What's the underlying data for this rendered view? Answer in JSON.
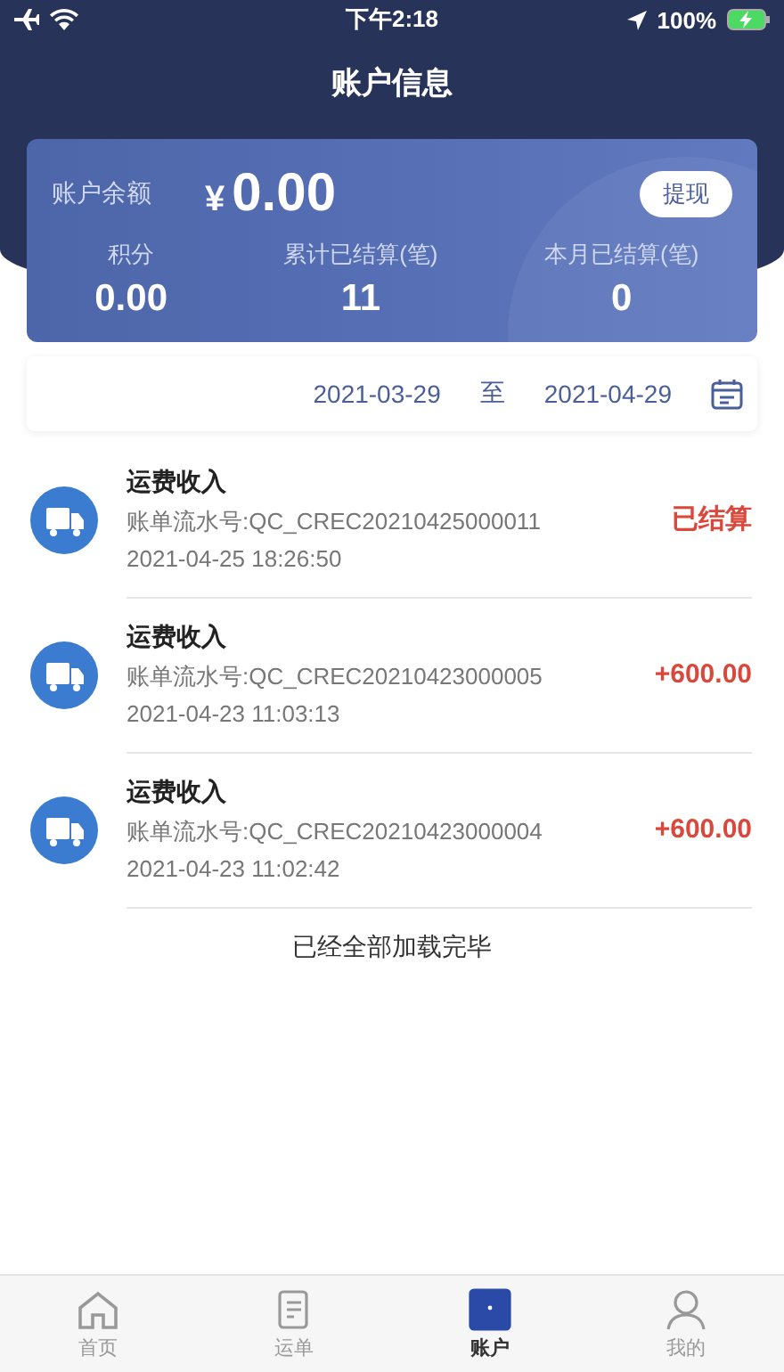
{
  "status_bar": {
    "time": "下午2:18",
    "battery": "100%"
  },
  "header": {
    "title": "账户信息"
  },
  "balance_card": {
    "label": "账户余额",
    "currency": "¥",
    "amount": "0.00",
    "withdraw_button": "提现",
    "stats": [
      {
        "label": "积分",
        "value": "0.00"
      },
      {
        "label": "累计已结算(笔)",
        "value": "11"
      },
      {
        "label": "本月已结算(笔)",
        "value": "0"
      }
    ]
  },
  "date_range": {
    "start": "2021-03-29",
    "separator": "至",
    "end": "2021-04-29"
  },
  "transactions": [
    {
      "title": "运费收入",
      "serial": "账单流水号:QC_CREC20210425000011",
      "time": "2021-04-25 18:26:50",
      "amount": "已结算"
    },
    {
      "title": "运费收入",
      "serial": "账单流水号:QC_CREC20210423000005",
      "time": "2021-04-23 11:03:13",
      "amount": "+600.00"
    },
    {
      "title": "运费收入",
      "serial": "账单流水号:QC_CREC20210423000004",
      "time": "2021-04-23 11:02:42",
      "amount": "+600.00"
    }
  ],
  "list_footer": "已经全部加载完毕",
  "tab_bar": [
    {
      "label": "首页",
      "kind": "home",
      "selected": false
    },
    {
      "label": "运单",
      "kind": "orders",
      "selected": false
    },
    {
      "label": "账户",
      "kind": "account",
      "selected": true
    },
    {
      "label": "我的",
      "kind": "profile",
      "selected": false
    }
  ]
}
